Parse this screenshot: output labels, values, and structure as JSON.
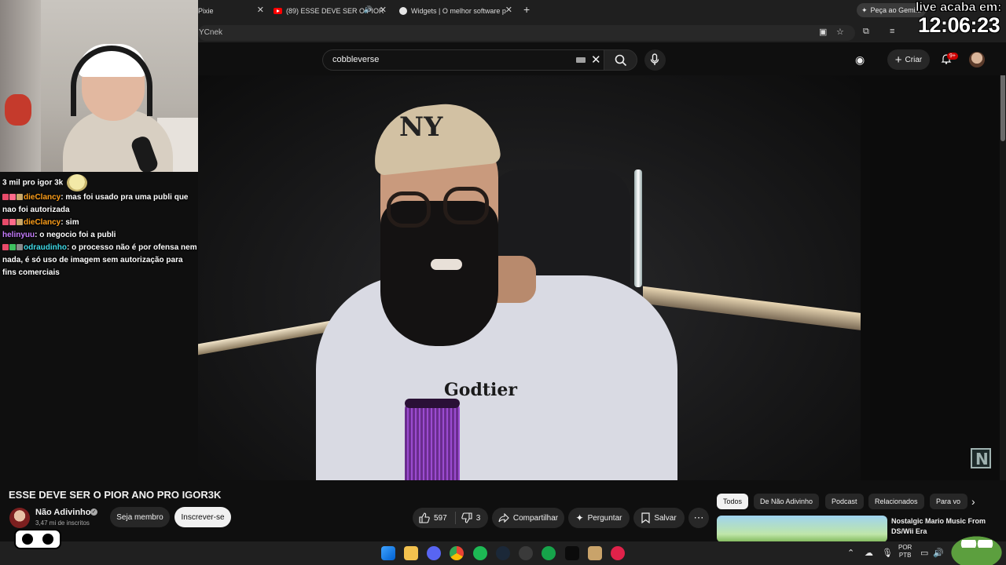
{
  "browser": {
    "tabs": [
      {
        "label": "Pixie"
      },
      {
        "label": "(89) ESSE DEVE SER O PIOR"
      },
      {
        "label": "Widgets | O melhor software p"
      }
    ],
    "gemini_label": "Peça ao Gemini",
    "url_fragment": "YCnek"
  },
  "youtube": {
    "search_value": "cobbleverse",
    "create_label": "Criar",
    "notif_badge": "9+"
  },
  "overlay": {
    "timer_label": "live acaba em:",
    "timer_value": "12:06:23",
    "chat": [
      {
        "user": "",
        "text": "3 mil pro igor 3k",
        "color": "#ffffff"
      },
      {
        "user": "dieClancy",
        "text": "mas foi usado pra uma publi que nao foi autorizada",
        "color": "#ff9f1a"
      },
      {
        "user": "dieClancy",
        "text": "sim",
        "color": "#ff9f1a"
      },
      {
        "user": "helinyuu",
        "text": "o negocio foi a publi",
        "color": "#c77dff"
      },
      {
        "user": "odraudinho",
        "text": "o processo não é por ofensa nem nada, é só uso de imagem sem autorização para fins comerciais",
        "color": "#3fd9e6"
      }
    ]
  },
  "video": {
    "title": "ESSE DEVE SER O PIOR ANO PRO IGOR3K",
    "cap_logo": "NY",
    "shirt_logo": "Godtier",
    "channel_name": "Não Adivinho",
    "subscribers": "3,47 mi de inscritos",
    "join_label": "Seja membro",
    "subscribe_label": "Inscrever-se",
    "likes": "597",
    "dislikes": "3",
    "share_label": "Compartilhar",
    "ask_label": "Perguntar",
    "save_label": "Salvar"
  },
  "sidebar": {
    "chips": [
      "Todos",
      "De Não Adivinho",
      "Podcast",
      "Relacionados",
      "Para vo"
    ],
    "recommendation": {
      "title": "Nostalgic Mario Music From DS/Wii Era"
    }
  },
  "taskbar": {
    "lang_top": "POR",
    "lang_bottom": "PTB"
  },
  "colors": {
    "youtube_red": "#ff0000",
    "notif_red": "#cc0000",
    "page_bg": "#0f0f0f"
  },
  "icons": [
    "close-icon",
    "audio-icon",
    "plus-icon",
    "gemini-icon",
    "star-icon",
    "extensions-icon",
    "search-icon",
    "mic-icon",
    "bell-icon",
    "like-icon",
    "dislike-icon",
    "share-icon",
    "ask-icon",
    "save-icon",
    "more-icon",
    "chevron-right-icon"
  ]
}
